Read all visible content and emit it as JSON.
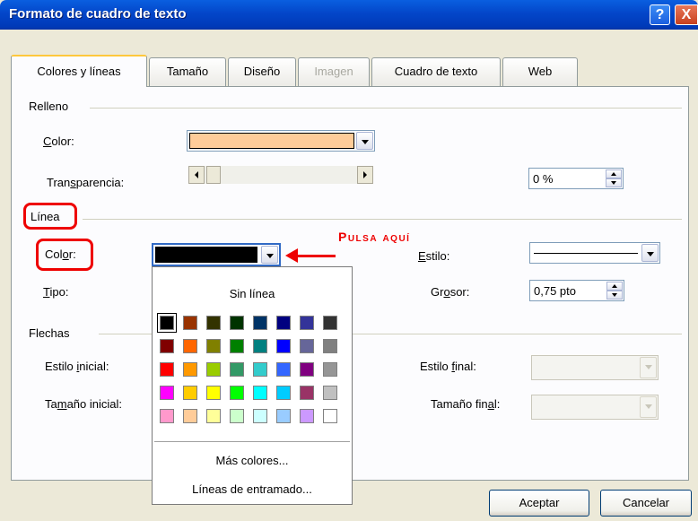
{
  "window": {
    "title": "Formato de cuadro de texto",
    "help": "?",
    "close": "X"
  },
  "tabs": [
    {
      "label": "Colores y líneas",
      "state": "active"
    },
    {
      "label": "Tamaño",
      "state": "normal"
    },
    {
      "label": "Diseño",
      "state": "normal"
    },
    {
      "label": "Imagen",
      "state": "disabled"
    },
    {
      "label": "Cuadro de texto",
      "state": "normal"
    },
    {
      "label": "Web",
      "state": "normal"
    }
  ],
  "relleno": {
    "group": "Relleno",
    "color_label": "Color:",
    "color_value": "#ffcc99",
    "transparencia_label": "Transparencia:",
    "transparencia_value": "0 %"
  },
  "linea": {
    "group": "Línea",
    "color_label": "Color:",
    "color_value": "#000000",
    "tipo_label": "Tipo:",
    "estilo_label": "Estilo:",
    "grosor_label": "Grosor:",
    "grosor_value": "0,75 pto"
  },
  "annotation": {
    "text": "Pulsa aquí",
    "color": "#e00000"
  },
  "flechas": {
    "group": "Flechas",
    "estilo_inicial_label": "Estilo inicial:",
    "tamano_inicial_label": "Tamaño inicial:",
    "estilo_final_label": "Estilo final:",
    "tamano_final_label": "Tamaño final:"
  },
  "color_dropdown": {
    "no_line": "Sin línea",
    "palette": [
      [
        "#000000",
        "#993300",
        "#333300",
        "#003300",
        "#003366",
        "#000080",
        "#333399",
        "#333333"
      ],
      [
        "#800000",
        "#ff6600",
        "#808000",
        "#008000",
        "#008080",
        "#0000ff",
        "#666699",
        "#808080"
      ],
      [
        "#ff0000",
        "#ff9900",
        "#99cc00",
        "#339966",
        "#33cccc",
        "#3366ff",
        "#800080",
        "#969696"
      ],
      [
        "#ff00ff",
        "#ffcc00",
        "#ffff00",
        "#00ff00",
        "#00ffff",
        "#00ccff",
        "#993366",
        "#c0c0c0"
      ],
      [
        "#ff99cc",
        "#ffcc99",
        "#ffff99",
        "#ccffcc",
        "#ccffff",
        "#99ccff",
        "#cc99ff",
        "#ffffff"
      ]
    ],
    "selected": "#000000",
    "more_colors": "Más colores...",
    "patterned_lines": "Líneas de entramado..."
  },
  "buttons": {
    "ok": "Aceptar",
    "cancel": "Cancelar"
  }
}
